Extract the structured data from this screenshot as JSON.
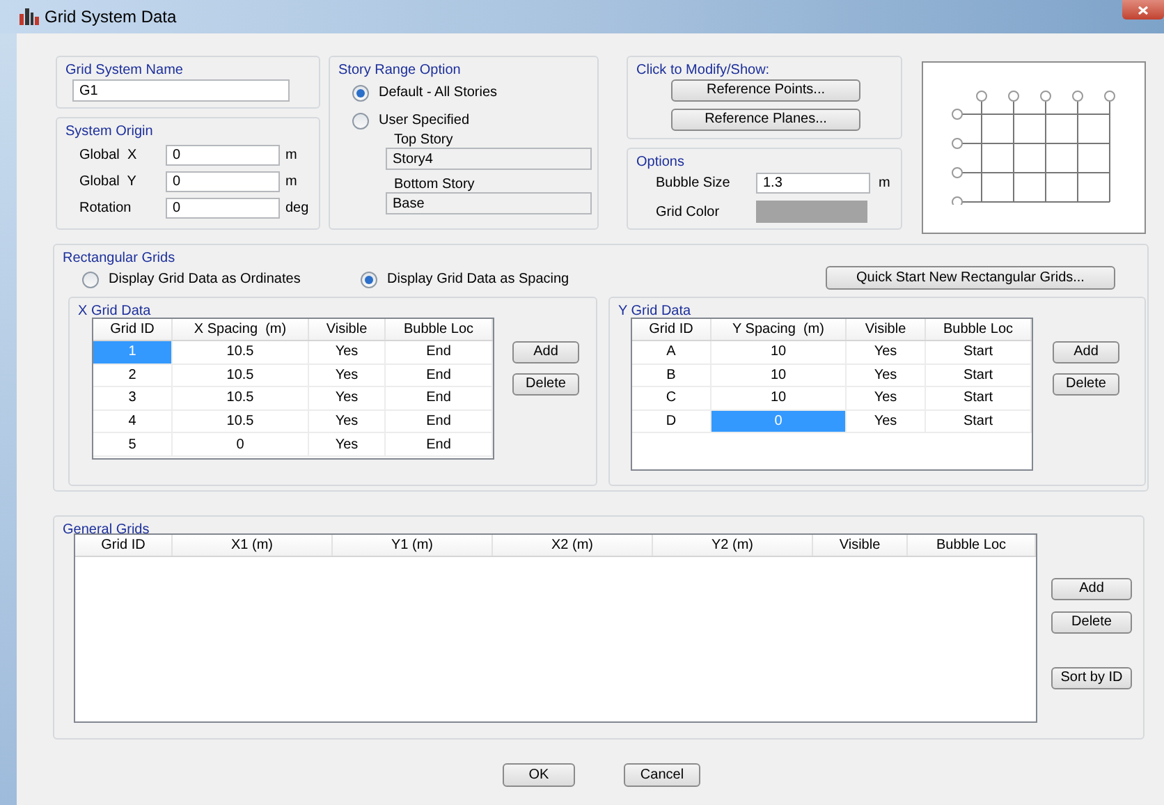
{
  "window": {
    "title": "Grid System Data"
  },
  "grid_system_name": {
    "label": "Grid System Name",
    "value": "G1"
  },
  "system_origin": {
    "label": "System Origin",
    "fields": [
      {
        "label": "Global  X",
        "value": "0",
        "unit": "m"
      },
      {
        "label": "Global  Y",
        "value": "0",
        "unit": "m"
      },
      {
        "label": "Rotation",
        "value": "0",
        "unit": "deg"
      }
    ]
  },
  "story_range": {
    "label": "Story Range Option",
    "options": [
      {
        "label": "Default - All Stories",
        "selected": true
      },
      {
        "label": "User Specified",
        "selected": false
      }
    ],
    "top_story": {
      "label": "Top Story",
      "value": "Story4"
    },
    "bottom_story": {
      "label": "Bottom Story",
      "value": "Base"
    }
  },
  "modify_show": {
    "label": "Click to Modify/Show:",
    "buttons": [
      "Reference Points...",
      "Reference Planes..."
    ]
  },
  "options": {
    "label": "Options",
    "bubble_size": {
      "label": "Bubble Size",
      "value": "1.3",
      "unit": "m"
    },
    "grid_color": {
      "label": "Grid Color",
      "color": "#a3a3a3"
    }
  },
  "rectangular_grids": {
    "label": "Rectangular Grids",
    "display_options": [
      {
        "label": "Display Grid Data as Ordinates",
        "selected": false
      },
      {
        "label": "Display Grid Data as Spacing",
        "selected": true
      }
    ],
    "quick_start_button": "Quick Start New Rectangular Grids...",
    "x_grid": {
      "label": "X Grid Data",
      "columns": [
        "Grid ID",
        "X Spacing  (m)",
        "Visible",
        "Bubble Loc"
      ],
      "rows": [
        [
          {
            "text": "1",
            "selected": true
          },
          {
            "text": "10.5",
            "selected": false
          },
          {
            "text": "Yes",
            "selected": false
          },
          {
            "text": "End",
            "selected": false
          }
        ],
        [
          {
            "text": "2",
            "selected": false
          },
          {
            "text": "10.5",
            "selected": false
          },
          {
            "text": "Yes",
            "selected": false
          },
          {
            "text": "End",
            "selected": false
          }
        ],
        [
          {
            "text": "3",
            "selected": false
          },
          {
            "text": "10.5",
            "selected": false
          },
          {
            "text": "Yes",
            "selected": false
          },
          {
            "text": "End",
            "selected": false
          }
        ],
        [
          {
            "text": "4",
            "selected": false
          },
          {
            "text": "10.5",
            "selected": false
          },
          {
            "text": "Yes",
            "selected": false
          },
          {
            "text": "End",
            "selected": false
          }
        ],
        [
          {
            "text": "5",
            "selected": false
          },
          {
            "text": "0",
            "selected": false
          },
          {
            "text": "Yes",
            "selected": false
          },
          {
            "text": "End",
            "selected": false
          }
        ]
      ],
      "buttons": [
        "Add",
        "Delete"
      ]
    },
    "y_grid": {
      "label": "Y Grid Data",
      "columns": [
        "Grid ID",
        "Y Spacing  (m)",
        "Visible",
        "Bubble Loc"
      ],
      "rows": [
        [
          {
            "text": "A",
            "selected": false
          },
          {
            "text": "10",
            "selected": false
          },
          {
            "text": "Yes",
            "selected": false
          },
          {
            "text": "Start",
            "selected": false
          }
        ],
        [
          {
            "text": "B",
            "selected": false
          },
          {
            "text": "10",
            "selected": false
          },
          {
            "text": "Yes",
            "selected": false
          },
          {
            "text": "Start",
            "selected": false
          }
        ],
        [
          {
            "text": "C",
            "selected": false
          },
          {
            "text": "10",
            "selected": false
          },
          {
            "text": "Yes",
            "selected": false
          },
          {
            "text": "Start",
            "selected": false
          }
        ],
        [
          {
            "text": "D",
            "selected": false
          },
          {
            "text": "0",
            "selected": true
          },
          {
            "text": "Yes",
            "selected": false
          },
          {
            "text": "Start",
            "selected": false
          }
        ]
      ],
      "buttons": [
        "Add",
        "Delete"
      ]
    }
  },
  "general_grids": {
    "label": "General Grids",
    "columns": [
      "Grid ID",
      "X1 (m)",
      "Y1 (m)",
      "X2 (m)",
      "Y2 (m)",
      "Visible",
      "Bubble Loc"
    ],
    "buttons": [
      "Add",
      "Delete",
      "Sort by ID"
    ]
  },
  "buttons": [
    "OK",
    "Cancel"
  ]
}
